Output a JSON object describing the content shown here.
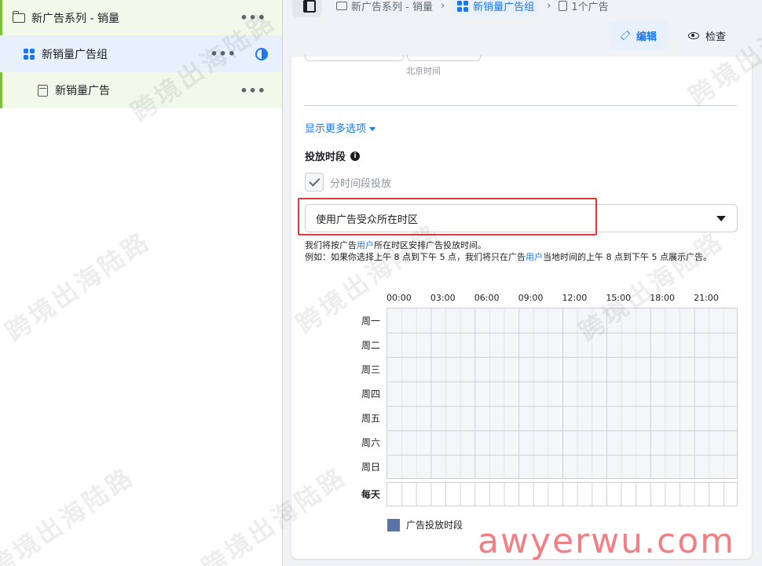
{
  "tree": {
    "campaign_label": "新广告系列 - 销量",
    "adset_label": "新销量广告组",
    "ad_label": "新销量广告",
    "more_glyph": "•••",
    "colors": {
      "accent_green": "#7ebf3b",
      "selected_bg": "#e7f0fb",
      "brand_blue": "#1877f2"
    }
  },
  "header": {
    "breadcrumb": [
      {
        "label": "新广告系列 - 销量"
      },
      {
        "label": "新销量广告组"
      },
      {
        "label": "1个广告"
      }
    ],
    "separator": "›",
    "edit_label": "编辑",
    "view_label": "检查"
  },
  "schedule_section": {
    "timezone_note": "北京时间",
    "more_options_label": "显示更多选项",
    "title": "投放时段",
    "info_glyph": "i",
    "checkbox_label": "分时间段投放",
    "timezone_select_value": "使用广告受众所在时区",
    "desc_part1": "我们将按广告",
    "desc_link1": "用户",
    "desc_part2": "所在时区安排广告投放时间。",
    "desc_part3": "例如：如果你选择上午 8 点到下午 5 点，我们将只在广告",
    "desc_link2": "用户",
    "desc_part4": "当地时间的上午 8 点到下午 5 点展示广告。",
    "hours": [
      "00:00",
      "03:00",
      "06:00",
      "09:00",
      "12:00",
      "15:00",
      "18:00",
      "21:00"
    ],
    "days": [
      "周一",
      "周二",
      "周三",
      "周四",
      "周五",
      "周六",
      "周日"
    ],
    "everyday_label": "每天",
    "legend_label": "广告投放时段",
    "legend_color": "#5b74a8"
  },
  "watermarks": {
    "text": "跨境出海陆路",
    "brand": "awyerwu.com"
  }
}
